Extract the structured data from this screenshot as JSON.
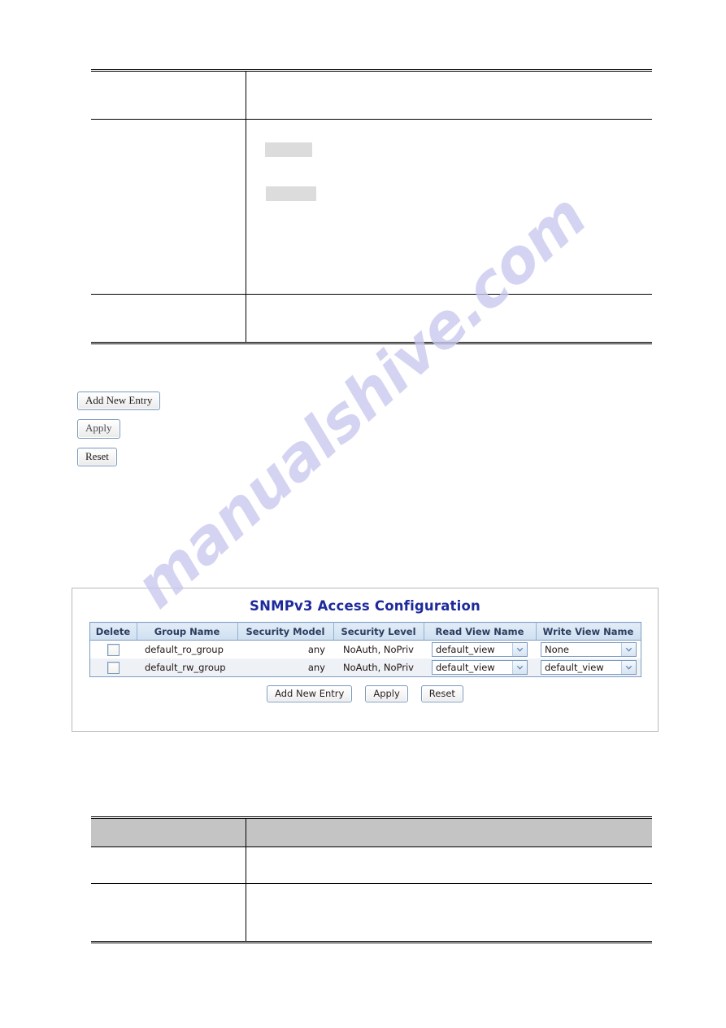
{
  "watermark": {
    "text": "manualshive.com",
    "color": "#c9c9ef"
  },
  "doc_buttons": {
    "add_new_entry": "Add New Entry",
    "apply": "Apply",
    "reset": "Reset"
  },
  "top_table": {
    "rows": [
      {
        "label": "",
        "description": ""
      },
      {
        "label": "",
        "description": ""
      },
      {
        "label": "",
        "description": ""
      }
    ],
    "redactions": [
      {
        "name": "redaction-block-1"
      },
      {
        "name": "redaction-block-2"
      }
    ]
  },
  "bottom_table": {
    "header": {
      "label": "",
      "description": ""
    },
    "rows": [
      {
        "label": "",
        "description": ""
      },
      {
        "label": "",
        "description": ""
      }
    ]
  },
  "screenshot": {
    "title": "SNMPv3 Access Configuration",
    "title_color": "#1d2a9b",
    "table": {
      "columns": [
        "Delete",
        "Group Name",
        "Security Model",
        "Security Level",
        "Read View Name",
        "Write View Name"
      ],
      "rows": [
        {
          "delete_checked": false,
          "group_name": "default_ro_group",
          "security_model": "any",
          "security_level": "NoAuth, NoPriv",
          "read_view_name": "default_view",
          "write_view_name": "None"
        },
        {
          "delete_checked": false,
          "group_name": "default_rw_group",
          "security_model": "any",
          "security_level": "NoAuth, NoPriv",
          "read_view_name": "default_view",
          "write_view_name": "default_view"
        }
      ]
    },
    "buttons": {
      "add_new_entry": "Add New Entry",
      "apply": "Apply",
      "reset": "Reset"
    }
  }
}
